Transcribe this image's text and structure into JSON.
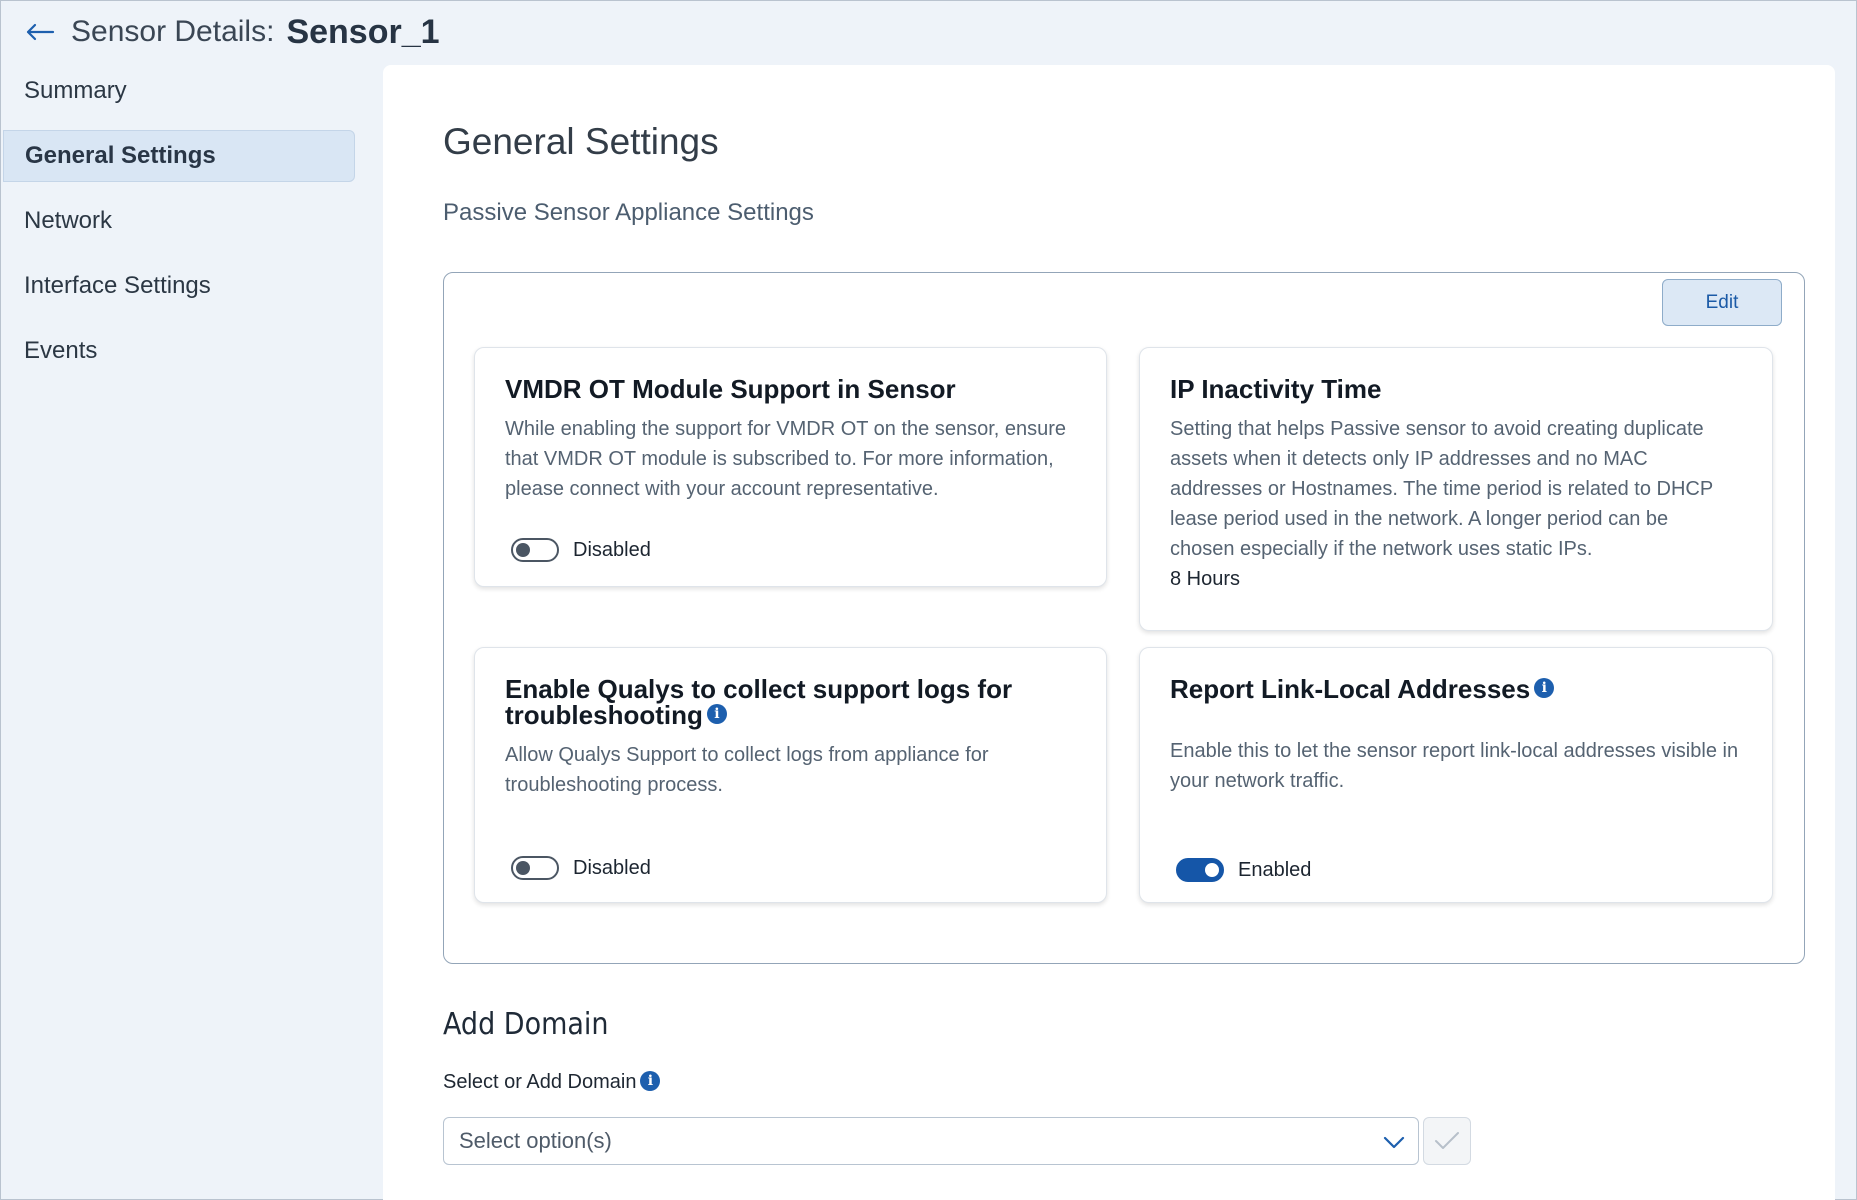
{
  "header": {
    "label": "Sensor Details:",
    "sensor_name": "Sensor_1"
  },
  "sidebar": {
    "items": [
      {
        "label": "Summary",
        "active": false
      },
      {
        "label": "General Settings",
        "active": true
      },
      {
        "label": "Network",
        "active": false
      },
      {
        "label": "Interface Settings",
        "active": false
      },
      {
        "label": "Events",
        "active": false
      }
    ]
  },
  "main": {
    "title": "General Settings",
    "subtitle": "Passive Sensor Appliance Settings",
    "edit_label": "Edit",
    "cards": {
      "vmdr": {
        "title": "VMDR OT Module Support in Sensor",
        "description": "While enabling the support for VMDR OT on the sensor, ensure that VMDR OT module is subscribed to. For more information, please connect with your account representative.",
        "status": "Disabled"
      },
      "ip_inactivity": {
        "title": "IP Inactivity Time",
        "description": "Setting that helps Passive sensor to avoid creating duplicate assets when it detects only IP addresses and no MAC addresses or Hostnames. The time period is related to DHCP lease period used in the network. A longer period can be chosen especially if the network uses static IPs.",
        "value": "8 Hours"
      },
      "support_logs": {
        "title": "Enable Qualys to collect support logs for troubleshooting",
        "description": "Allow Qualys Support to collect logs from appliance for troubleshooting process.",
        "status": "Disabled"
      },
      "link_local": {
        "title": "Report Link-Local Addresses",
        "description": "Enable this to let the sensor report link-local addresses visible in your network traffic.",
        "status": "Enabled"
      }
    },
    "domain": {
      "title": "Add Domain",
      "label": "Select or Add Domain",
      "placeholder": "Select option(s)"
    }
  },
  "colors": {
    "accent": "#1556a8",
    "active_bg": "#d9e6f4",
    "page_bg": "#eef3f9"
  }
}
